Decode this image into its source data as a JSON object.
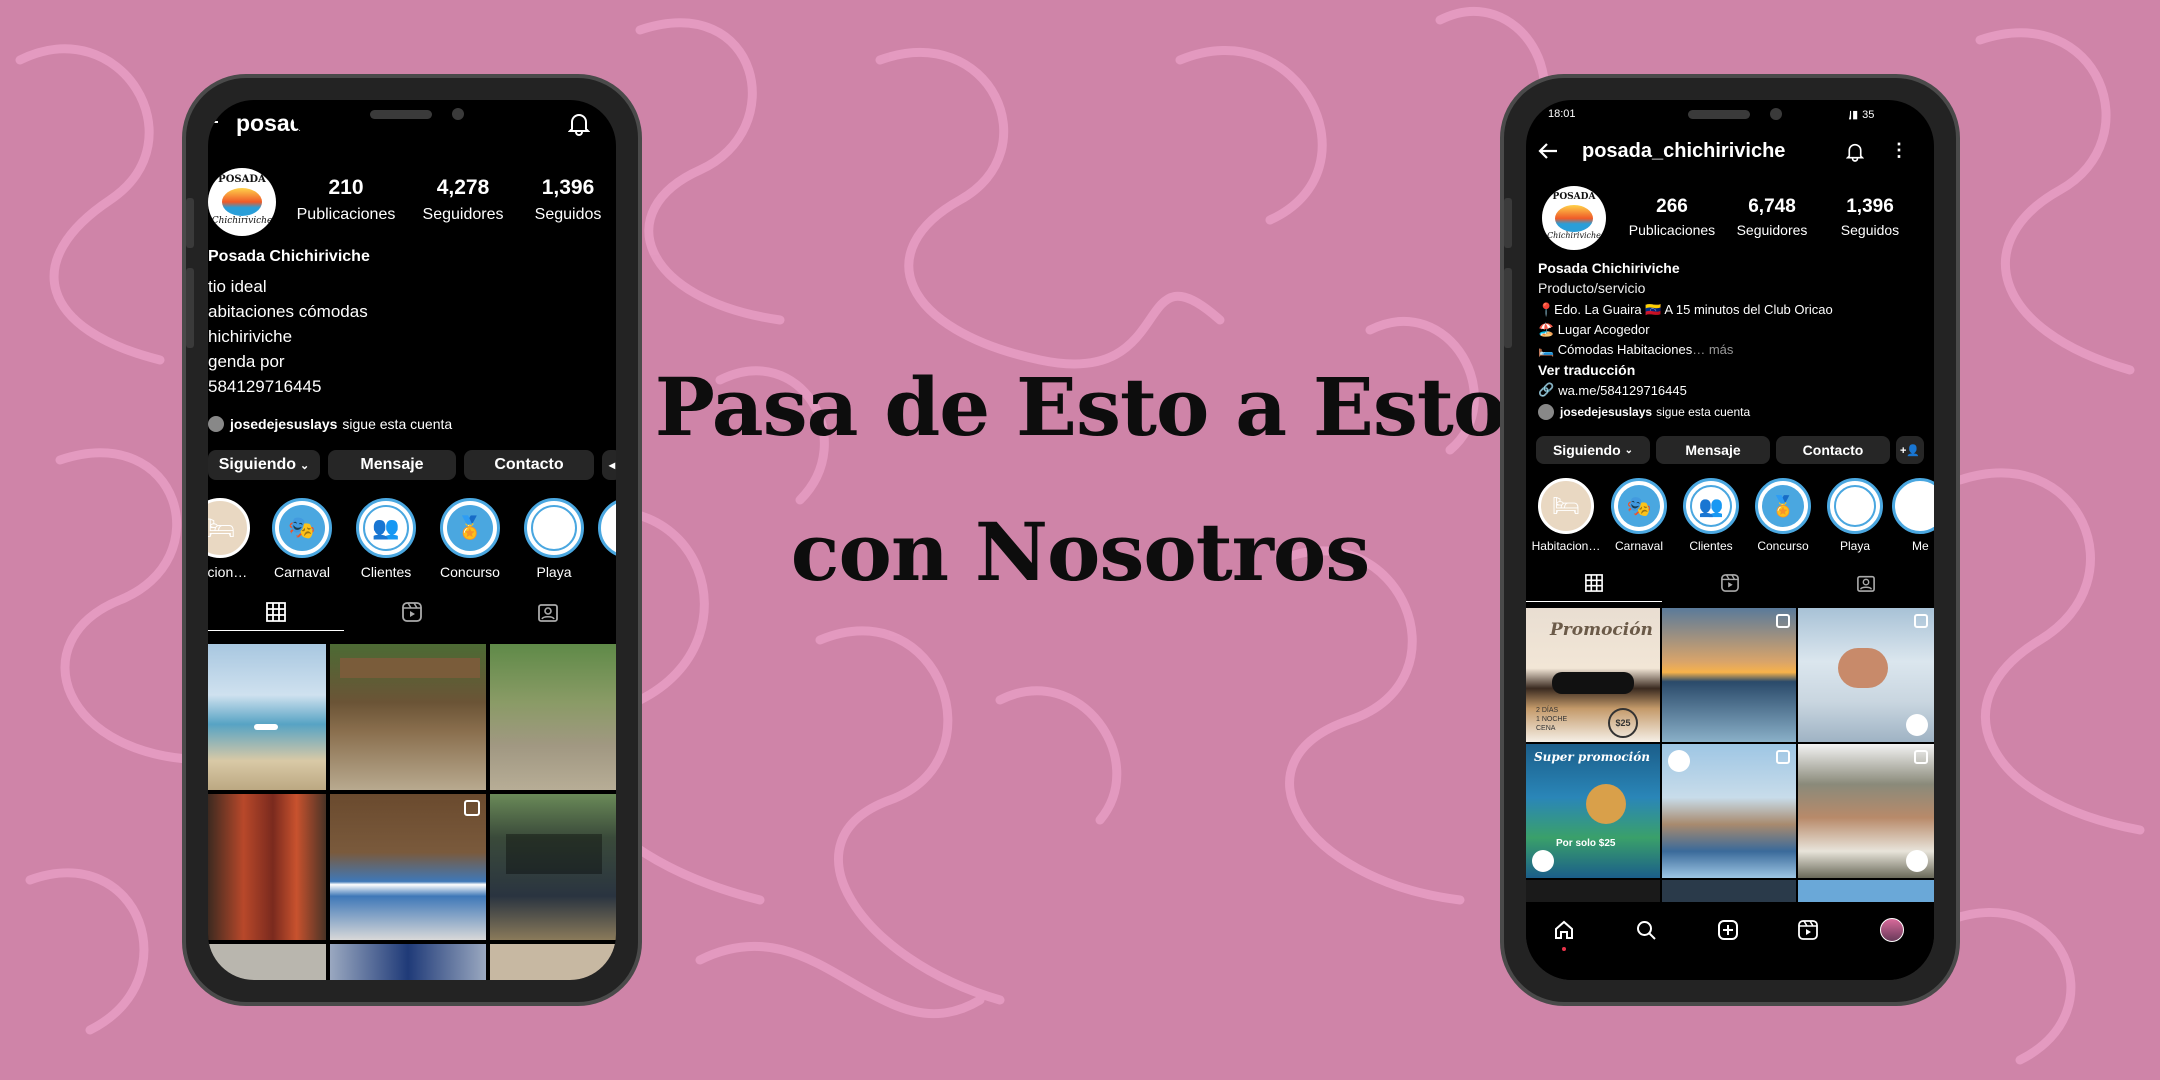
{
  "headline": {
    "line1": "Pasa de Esto a Esto",
    "line2": "con Nosotros"
  },
  "colors": {
    "background": "#cf84a8",
    "swirl": "#e69cc2",
    "accent": "#4aa7e0"
  },
  "before": {
    "username": "posada_chichiriviche",
    "avatar_text": {
      "top": "POSADA",
      "bottom": "Chichiriviche"
    },
    "stats": [
      {
        "value": "210",
        "label": "Publicaciones"
      },
      {
        "value": "4,278",
        "label": "Seguidores"
      },
      {
        "value": "1,396",
        "label": "Seguidos"
      }
    ],
    "display_name": "Posada Chichiriviche",
    "bio": [
      "tio ideal",
      "abitaciones cómodas",
      "hichiriviche",
      "genda por",
      "584129716445"
    ],
    "followed_by": {
      "user": "josedejesuslays",
      "text": "sigue esta cuenta"
    },
    "buttons": {
      "following": "Siguiendo",
      "message": "Mensaje",
      "contact": "Contacto"
    },
    "highlights": [
      "itacion…",
      "Carnaval",
      "Clientes",
      "Concurso",
      "Playa"
    ],
    "icons": {
      "back": "back-arrow-icon",
      "bell": "bell-icon"
    }
  },
  "after": {
    "status_bar": {
      "time": "18:01",
      "battery": "35"
    },
    "username": "posada_chichiriviche",
    "avatar_text": {
      "top": "POSADA",
      "bottom": "Chichiriviche"
    },
    "stats": [
      {
        "value": "266",
        "label": "Publicaciones"
      },
      {
        "value": "6,748",
        "label": "Seguidores"
      },
      {
        "value": "1,396",
        "label": "Seguidos"
      }
    ],
    "display_name": "Posada Chichiriviche",
    "category": "Producto/servicio",
    "bio": [
      "📍Edo. La Guaira 🇻🇪 A 15 minutos del Club Oricao",
      "🏖️ Lugar Acogedor",
      "🛏️ Cómodas Habitaciones"
    ],
    "more": "… más",
    "translate": "Ver traducción",
    "link": "wa.me/584129716445",
    "followed_by": {
      "user": "josedejesuslays",
      "text": "sigue esta cuenta"
    },
    "buttons": {
      "following": "Siguiendo",
      "message": "Mensaje",
      "contact": "Contacto"
    },
    "highlights": [
      "Habitacion…",
      "Carnaval",
      "Clientes",
      "Concurso",
      "Playa",
      "Me"
    ],
    "post_text": {
      "promo1": "Promoción",
      "promo1_price": "$25",
      "promo1_lines": [
        "2 DÍAS",
        "1 NOCHE",
        "CENA"
      ],
      "promo2": "Super promoción",
      "promo2_price": "Por solo $25"
    }
  }
}
